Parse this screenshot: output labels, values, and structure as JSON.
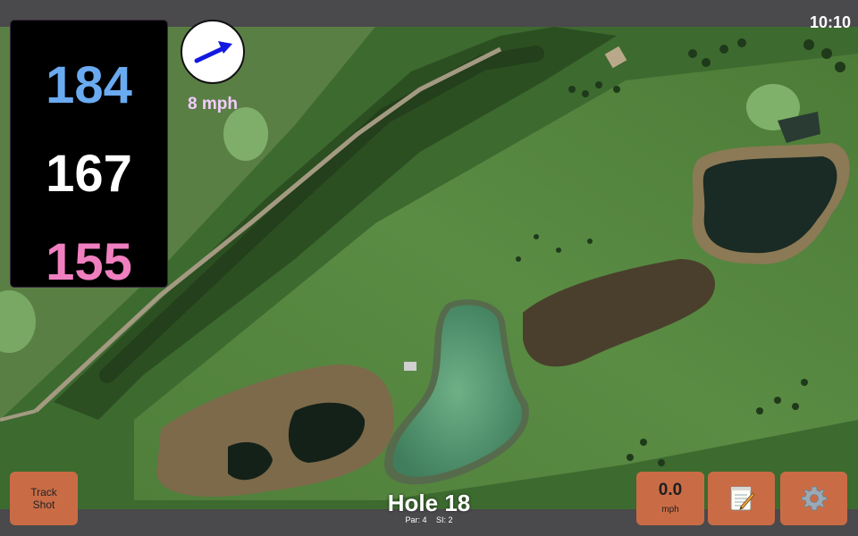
{
  "status_bar": {
    "time": "10:10"
  },
  "distances": {
    "back": "184",
    "middle": "167",
    "front": "155"
  },
  "wind": {
    "speed": "8 mph",
    "icon": "wind-direction-arrow-icon"
  },
  "buttons": {
    "track_shot_line1": "Track",
    "track_shot_line2": "Shot",
    "speed_value": "0.0",
    "speed_unit": "mph",
    "notes_icon": "notepad-icon",
    "settings_icon": "gear-icon"
  },
  "hole": {
    "title": "Hole 18",
    "par": "Par: 4",
    "si": "SI: 2"
  },
  "colors": {
    "back_distance": "#6aaaf0",
    "middle_distance": "#ffffff",
    "front_distance": "#f07fc0",
    "wind_text": "#f4ccff",
    "button": "#c96c46",
    "bar": "#4a494c"
  }
}
